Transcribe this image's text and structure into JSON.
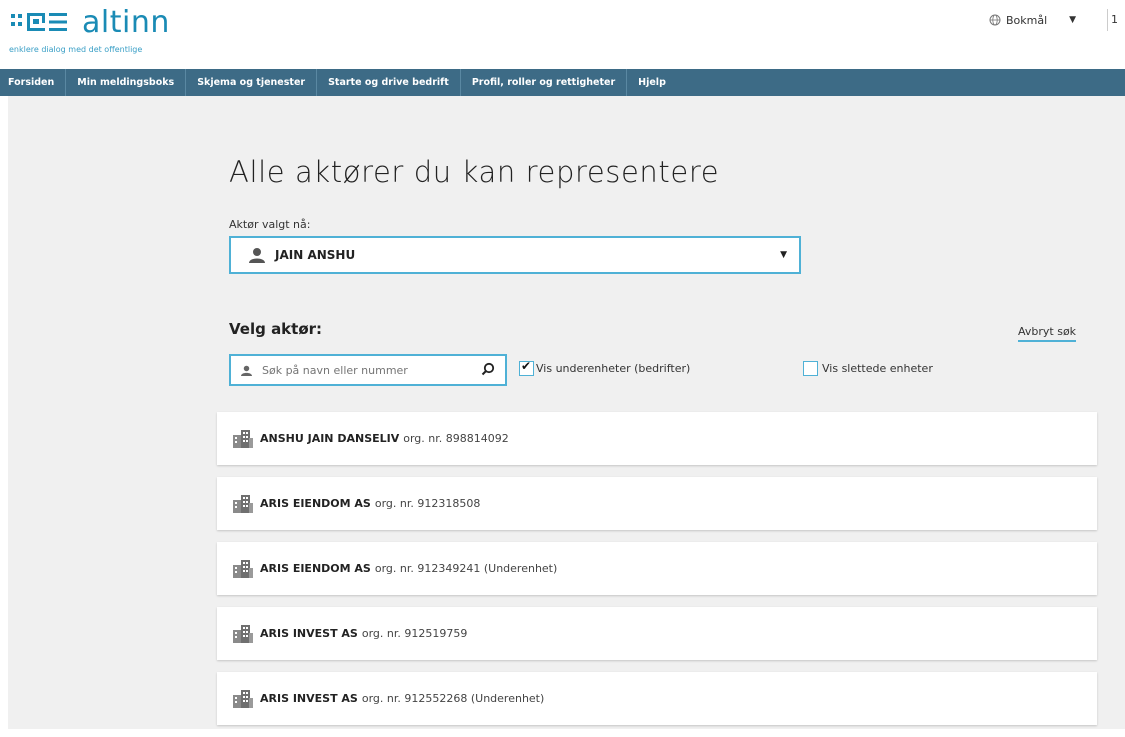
{
  "header": {
    "logo_text": "altinn",
    "tagline": "enklere dialog med det offentlige",
    "language": "Bokmål",
    "edge_text": "1"
  },
  "nav": {
    "items": [
      "Forsiden",
      "Min meldingsboks",
      "Skjema og tjenester",
      "Starte og drive bedrift",
      "Profil, roller og rettigheter",
      "Hjelp"
    ]
  },
  "page": {
    "title": "Alle aktører du kan representere",
    "current_label": "Aktør valgt nå:",
    "current_actor": "JAIN ANSHU",
    "choose_label": "Velg aktør:",
    "cancel_search": "Avbryt søk",
    "search_placeholder": "Søk på navn eller nummer",
    "show_subunits": "Vis underenheter (bedrifter)",
    "show_deleted": "Vis slettede enheter"
  },
  "actors": [
    {
      "name": "ANSHU JAIN DANSELIV",
      "org": "org. nr. 898814092"
    },
    {
      "name": "ARIS EIENDOM AS",
      "org": "org. nr. 912318508"
    },
    {
      "name": "ARIS EIENDOM AS",
      "org": "org. nr. 912349241 (Underenhet)"
    },
    {
      "name": "ARIS INVEST AS",
      "org": "org. nr. 912519759"
    },
    {
      "name": "ARIS INVEST AS",
      "org": "org. nr. 912552268 (Underenhet)"
    }
  ],
  "colors": {
    "nav_bg": "#3d6b86",
    "accent": "#4fb1d6",
    "logo": "#1a8bb5",
    "page_bg": "#f0f0f0"
  },
  "icons": {
    "logo_mark": "altinn-logo-icon",
    "globe": "globe-icon",
    "person": "person-icon",
    "search": "search-icon",
    "building": "building-icon"
  }
}
